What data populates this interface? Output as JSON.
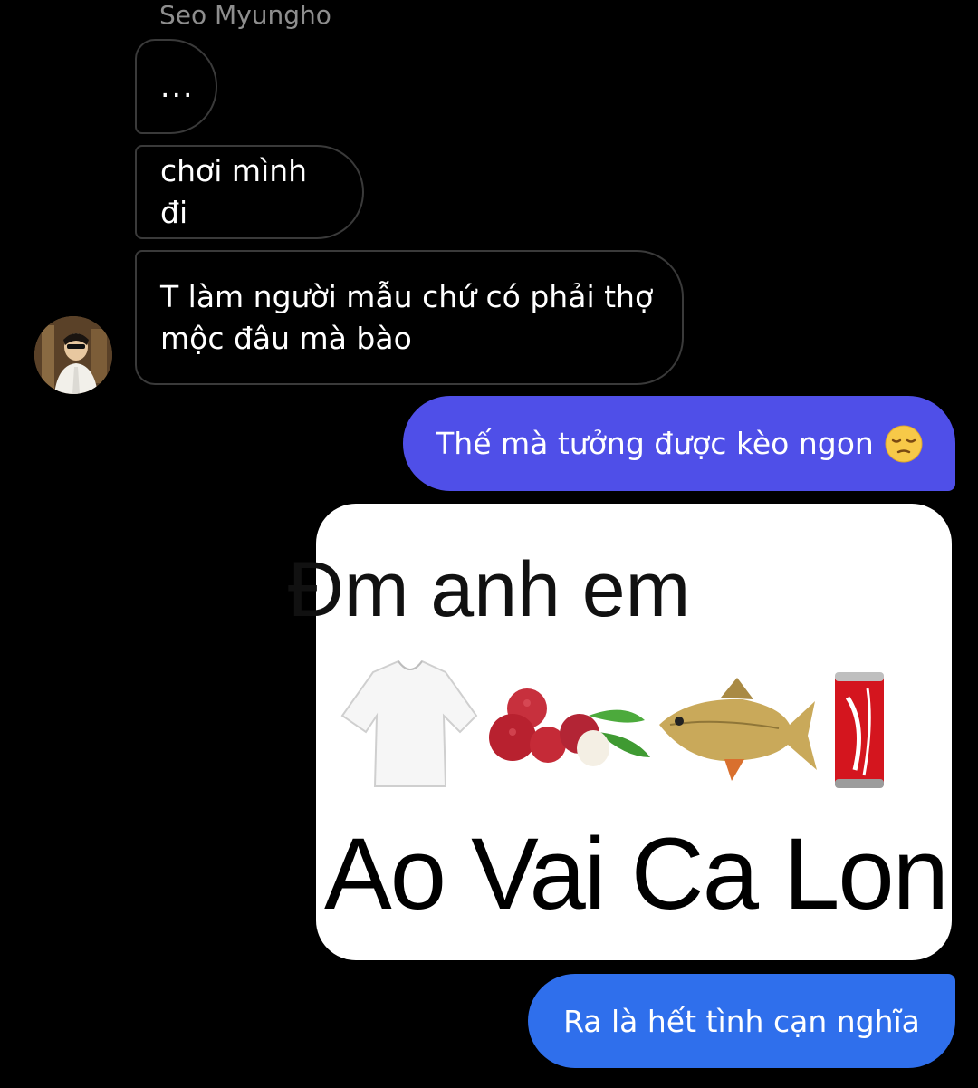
{
  "conversation": {
    "sender_name": "Seo Myungho",
    "incoming": [
      {
        "text": "..."
      },
      {
        "text": "chơi mình đi"
      },
      {
        "text": "T làm người mẫu chứ có phải thợ mộc đâu mà bào"
      }
    ],
    "outgoing": [
      {
        "text": "Thế mà tưởng được kèo ngon",
        "emoji": "pensive-face-emoji"
      },
      {
        "text": "Ra là hết tình cạn nghĩa"
      }
    ],
    "meme": {
      "title": "Đm anh em",
      "bottom_text": "Ao Vai Ca Lon",
      "icons": [
        "t-shirt-icon",
        "lychee-icon",
        "fish-icon",
        "cola-can-icon"
      ]
    }
  },
  "colors": {
    "background": "#000000",
    "incoming_border": "#3a3a3a",
    "outgoing_purple": "#4f4fe8",
    "outgoing_blue": "#2f6fec",
    "meta_text": "#8e8e8e"
  }
}
